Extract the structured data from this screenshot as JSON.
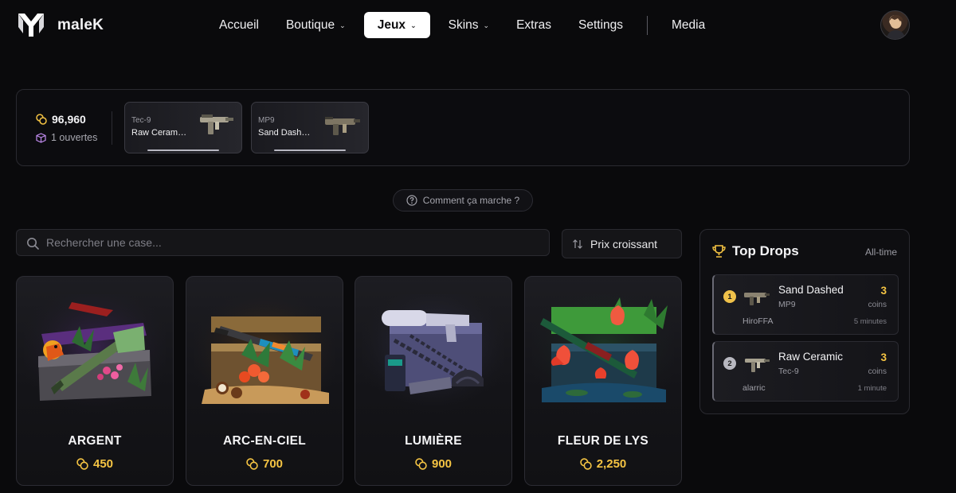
{
  "header": {
    "brand": "maleK",
    "nav": [
      {
        "label": "Accueil",
        "dropdown": false,
        "active": false
      },
      {
        "label": "Boutique",
        "dropdown": true,
        "active": false
      },
      {
        "label": "Jeux",
        "dropdown": true,
        "active": true
      },
      {
        "label": "Skins",
        "dropdown": true,
        "active": false
      },
      {
        "label": "Extras",
        "dropdown": false,
        "active": false
      },
      {
        "label": "Settings",
        "dropdown": false,
        "active": false
      },
      {
        "label": "Media",
        "dropdown": false,
        "active": false
      }
    ],
    "avatar_icon": "user-avatar"
  },
  "inventory": {
    "balance": "96,960",
    "opened": "1 ouvertes",
    "items": [
      {
        "category": "Tec-9",
        "name": "Raw Ceram…"
      },
      {
        "category": "MP9",
        "name": "Sand Dash…"
      }
    ]
  },
  "help": {
    "label": "Comment ça marche ?",
    "icon": "question-circle-icon"
  },
  "search": {
    "placeholder": "Rechercher une case...",
    "value": ""
  },
  "sort": {
    "label": "Prix croissant",
    "icon": "sort-arrows-icon"
  },
  "cases": [
    {
      "name": "ARGENT",
      "price": "450"
    },
    {
      "name": "ARC-EN-CIEL",
      "price": "700"
    },
    {
      "name": "LUMIÈRE",
      "price": "900"
    },
    {
      "name": "FLEUR DE LYS",
      "price": "2,250"
    }
  ],
  "top_drops": {
    "title": "Top Drops",
    "filter": "All-time",
    "entries": [
      {
        "rank": "1",
        "name": "Sand Dashed",
        "category": "MP9",
        "value": "3",
        "unit": "coins",
        "user": "HiroFFA",
        "time": "5 minutes"
      },
      {
        "rank": "2",
        "name": "Raw Ceramic",
        "category": "Tec-9",
        "value": "3",
        "unit": "coins",
        "user": "alarric",
        "time": "1 minute"
      }
    ]
  },
  "colors": {
    "background": "#0a0a0c",
    "accent_gold": "#f5c443",
    "nav_active_bg": "#ffffff",
    "rank_1": "#f0c24a",
    "rank_2": "#b8b8c0"
  }
}
